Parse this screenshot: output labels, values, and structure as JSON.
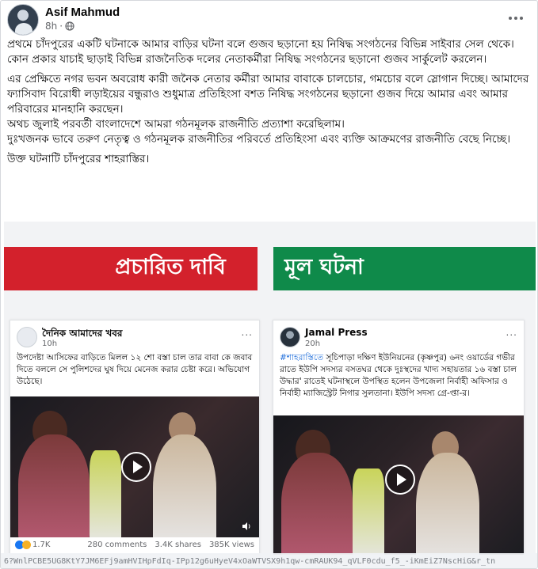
{
  "post": {
    "author": "Asif Mahmud",
    "time": "8h",
    "dot": "·",
    "paragraphs": [
      "প্রথমে চাঁদপুরের একটি ঘটনাকে আমার বাড়ির ঘটনা বলে গুজব ছড়ানো হয় নিষিদ্ধ সংগঠনের বিভিন্ন সাইবার সেল থেকে। কোন প্রকার যাচাই ছাড়াই বিভিন্ন রাজনৈতিক দলের নেতাকর্মীরা নিষিদ্ধ সংগঠনের ছড়ানো গুজব সার্কুলেট করলেন।",
      "এর প্রেক্ষিতে নগর ভবন অবরোধ কারী জনৈক নেতার কর্মীরা আমার বাবাকে চালচোর, গমচোর বলে স্লোগান দিচ্ছে। আমাদের ফ্যাসিবাদ বিরোধী লড়াইয়ের বন্ধুরাও শুধুমাত্র প্রতিহিংসা বশত নিষিদ্ধ সংগঠনের ছড়ানো গুজব দিয়ে আমার এবং আমার পরিবারের মানহানি করছেন।\nঅথচ জুলাই পরবর্তী বাংলাদেশে আমরা গঠনমূলক রাজনীতি প্রত্যাশা করেছিলাম।\nদুঃখজনক ভাবে তরুণ নেতৃত্ব ও গঠনমূলক রাজনীতির পরিবর্তে প্রতিহিংসা এবং ব্যক্তি আক্রমণের রাজনীতি বেছে নিচ্ছে।",
      "উক্ত ঘটনাটি চাঁদপুরের শাহরাস্তির।"
    ]
  },
  "media": {
    "banner_left": "প্রচারিত দাবি",
    "banner_right": "মূল ঘটনা",
    "left_card": {
      "page_name": "দৈনিক আমাদের খবর",
      "time": "10h",
      "more": "...",
      "text": "উপদেষ্টা আসিফের বাড়িতে মিলল ১২ শো বস্তা চাল  তার বাবা কে জবাব দিতে বললে সে পুলিশদের ঘুষ দিয়ে মেনেজ করার চেষ্টা করে। অভিযোগ উঠেছে।",
      "reactions": "1.7K",
      "comments": "280 comments",
      "shares": "3.4K shares",
      "views": "385K views"
    },
    "right_card": {
      "page_name": "Jamal Press",
      "time": "20h",
      "more": "...",
      "hashtag": "#শাহরাস্তিতে",
      "text": " সূচিপাড়া দক্ষিণ ইউনিয়নের (কৃষ্ণপুর) ৬নং ওয়ার্ডের গভীর রাতে ইউপি সদস্যর বসতঘর থেকে দুঃস্থদের খাদ্য সহায়তার ১৬ বস্তা চাল উদ্ধার' রাতেই ঘটনাস্থলে উপস্থিত হলেন উপজেলা নির্বাহী অফিসার ও নির্বাহী ম্যাজিস্ট্রেট নিগার সুলতানা। ইউপি সদস্য গ্রে-প্তা-র।"
    }
  },
  "url_strip": "6?WnlPCBE5UG8KtY7JM6EFj9amHVIHpFdIq-IPp12g6uHyeV4xOaWTVSX9h1qw-cmRAUK94_qVLF0cdu_f5_-iKmEiZ7NscHiG&r_tn",
  "colors": {
    "banner_red": "#d3212c",
    "banner_green": "#0f8a4a",
    "hashtag": "#216fdb"
  }
}
